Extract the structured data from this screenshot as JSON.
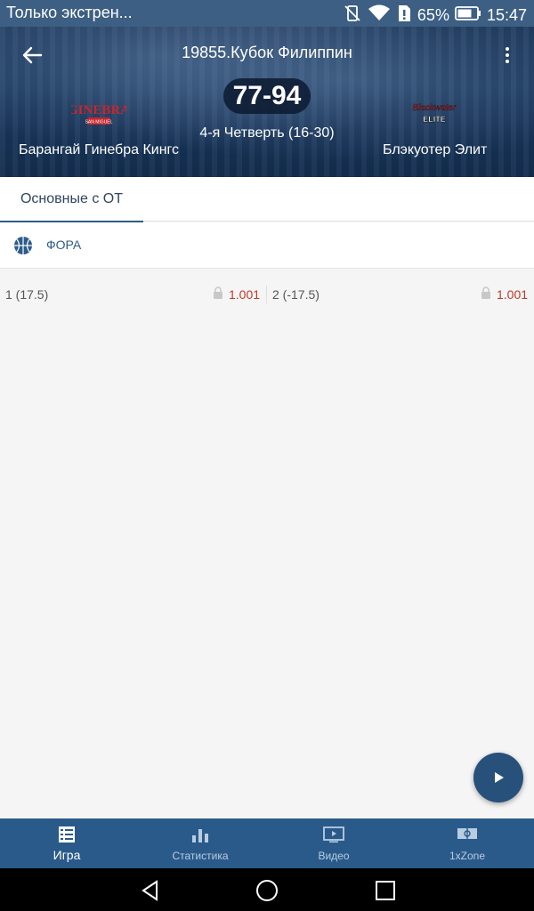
{
  "status_bar": {
    "notification_text": "Только экстрен...",
    "battery_percent": "65%",
    "time": "15:47",
    "icons": [
      "no-vibrate-icon",
      "wifi-icon",
      "sim-alert-icon",
      "battery-icon"
    ]
  },
  "header": {
    "title": "19855.Кубок Филиппин",
    "score": "77-94",
    "period": "4-я  Четверть (16-30)",
    "team_home": "Барангай Гинебра Кингс",
    "team_away": "Блэкуотер Элит",
    "logo_home_text": "GINEBRA",
    "logo_home_sub": "SAN MIGUEL",
    "logo_away_text": "Blackwater",
    "logo_away_sub": "ELITE"
  },
  "tabs": [
    {
      "label": "Основные с ОТ",
      "active": true
    }
  ],
  "market": {
    "title": "ФОРА",
    "odds": [
      {
        "name": "1 (17.5)",
        "value": "1.001",
        "locked": true
      },
      {
        "name": "2 (-17.5)",
        "value": "1.001",
        "locked": true
      }
    ]
  },
  "bottom_nav": [
    {
      "label": "Игра",
      "icon": "game-list-icon",
      "active": true
    },
    {
      "label": "Статистика",
      "icon": "bar-chart-icon",
      "active": false
    },
    {
      "label": "Видео",
      "icon": "video-icon",
      "active": false
    },
    {
      "label": "1xZone",
      "icon": "field-icon",
      "active": false
    }
  ],
  "colors": {
    "header_bg": "#1f3d60",
    "accent": "#2d5c8a",
    "odds_value": "#c0392b",
    "bottom_nav_bg": "#2a5a8a"
  }
}
